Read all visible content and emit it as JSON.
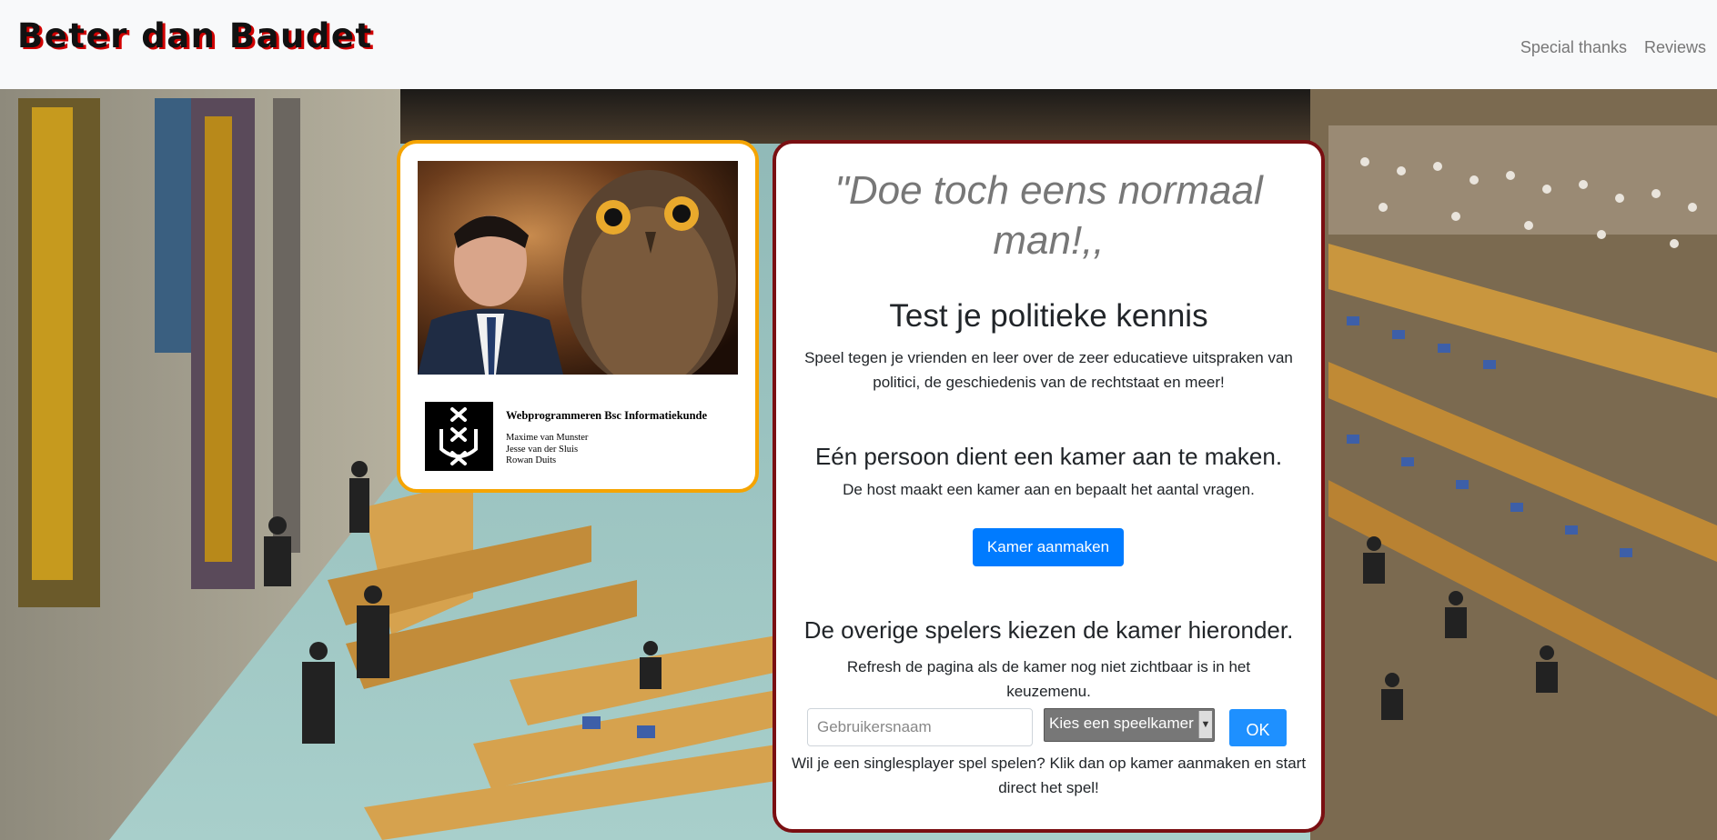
{
  "navbar": {
    "brand": "Beter dan Baudet",
    "links": [
      "Special thanks",
      "Reviews"
    ]
  },
  "left_card": {
    "credits_title": "Webprogrammeren Bsc Informatiekunde",
    "credits_names": [
      "Maxime van Munster",
      "Jesse van der Sluis",
      "Rowan Duits"
    ]
  },
  "main_card": {
    "quote": "\"Doe toch eens normaal man!,,",
    "test_heading": "Test je politieke kennis",
    "test_text": "Speel tegen je vrienden en leer over de zeer educatieve uitspraken van politici, de geschiedenis van de rechtstaat en meer!",
    "host_heading": "Eén persoon dient een kamer aan te maken.",
    "host_text": "De host maakt een kamer aan en bepaalt het aantal vragen.",
    "create_button": "Kamer aanmaken",
    "join_heading": "De overige spelers kiezen de kamer hieronder.",
    "join_text": "Refresh de pagina als de kamer nog niet zichtbaar is in het keuzemenu.",
    "username_placeholder": "Gebruikersnaam",
    "room_select": "Kies een speelkamer",
    "ok_button": "OK",
    "singleplayer_text": "Wil je een singlesplayer spel spelen? Klik dan op kamer aanmaken en start direct het spel!"
  },
  "colors": {
    "brand_shadow": "#d10000",
    "left_card_border": "#f5a400",
    "main_card_border": "#7a0f12",
    "primary_button": "#007bff"
  }
}
